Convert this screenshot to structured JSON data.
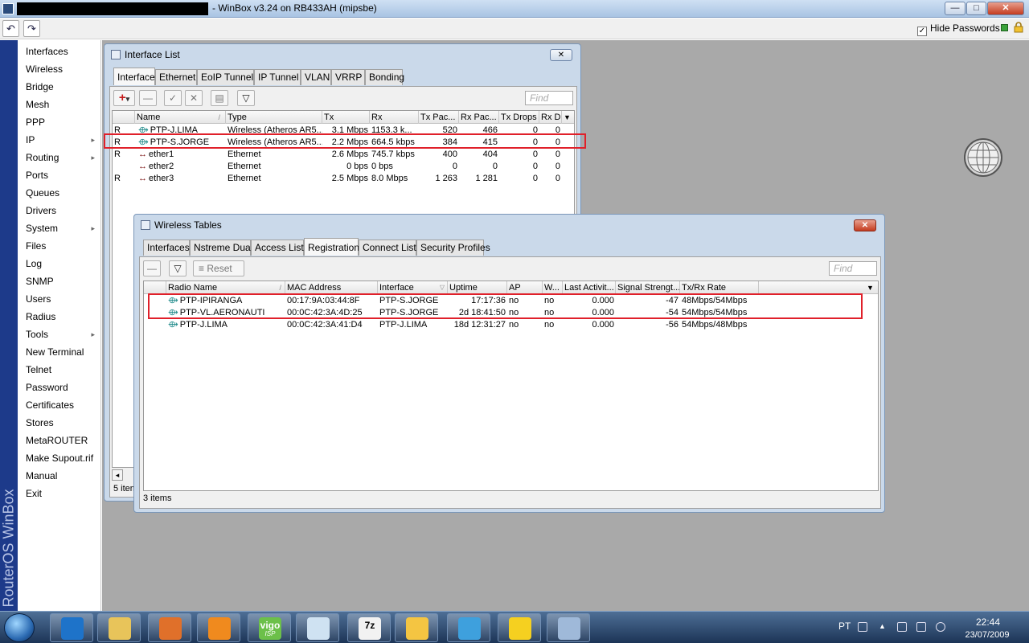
{
  "titlebar": {
    "title": "- WinBox v3.24 on RB433AH (mipsbe)",
    "min": "—",
    "max": "□",
    "close": "✕"
  },
  "toolbar": {
    "undo": "↶",
    "redo": "↷",
    "hide_passwords_label": "Hide Passwords",
    "hide_passwords_checked": "✓"
  },
  "side_label": "RouterOS WinBox",
  "menu": [
    {
      "label": "Interfaces"
    },
    {
      "label": "Wireless"
    },
    {
      "label": "Bridge"
    },
    {
      "label": "Mesh"
    },
    {
      "label": "PPP"
    },
    {
      "label": "IP",
      "arrow": "▸"
    },
    {
      "label": "Routing",
      "arrow": "▸"
    },
    {
      "label": "Ports"
    },
    {
      "label": "Queues"
    },
    {
      "label": "Drivers"
    },
    {
      "label": "System",
      "arrow": "▸"
    },
    {
      "label": "Files"
    },
    {
      "label": "Log"
    },
    {
      "label": "SNMP"
    },
    {
      "label": "Users"
    },
    {
      "label": "Radius"
    },
    {
      "label": "Tools",
      "arrow": "▸"
    },
    {
      "label": "New Terminal"
    },
    {
      "label": "Telnet"
    },
    {
      "label": "Password"
    },
    {
      "label": "Certificates"
    },
    {
      "label": "Stores"
    },
    {
      "label": "MetaROUTER"
    },
    {
      "label": "Make Supout.rif"
    },
    {
      "label": "Manual"
    },
    {
      "label": "Exit"
    }
  ],
  "iface_win": {
    "title": "Interface List",
    "close": "✕",
    "tabs": [
      "Interface",
      "Ethernet",
      "EoIP Tunnel",
      "IP Tunnel",
      "VLAN",
      "VRRP",
      "Bonding"
    ],
    "buttons": {
      "add": "+",
      "add_arrow": "▾",
      "remove": "—",
      "enable": "✓",
      "disable": "✕",
      "comment": "▤",
      "filter": "▽"
    },
    "find_placeholder": "Find",
    "columns": [
      "Name",
      "Type",
      "Tx",
      "Rx",
      "Tx Pac...",
      "Rx Pac...",
      "Tx Drops",
      "Rx D"
    ],
    "sort_arrow": "/",
    "rows": [
      {
        "flag": "R",
        "icon": "⟴",
        "name": "PTP-J.LIMA",
        "type": "Wireless (Atheros AR5...",
        "tx": "3.1 Mbps",
        "rx": "1153.3 k...",
        "txp": "520",
        "rxp": "466",
        "txd": "0",
        "rxd": "0"
      },
      {
        "flag": "R",
        "icon": "⟴",
        "name": "PTP-S.JORGE",
        "type": "Wireless (Atheros AR5...",
        "tx": "2.2 Mbps",
        "rx": "664.5 kbps",
        "txp": "384",
        "rxp": "415",
        "txd": "0",
        "rxd": "0"
      },
      {
        "flag": "R",
        "icon": "↔",
        "name": "ether1",
        "type": "Ethernet",
        "tx": "2.6 Mbps",
        "rx": "745.7 kbps",
        "txp": "400",
        "rxp": "404",
        "txd": "0",
        "rxd": "0"
      },
      {
        "flag": "",
        "icon": "↔",
        "name": "ether2",
        "type": "Ethernet",
        "tx": "0 bps",
        "rx": "0 bps",
        "txp": "0",
        "rxp": "0",
        "txd": "0",
        "rxd": "0"
      },
      {
        "flag": "R",
        "icon": "↔",
        "name": "ether3",
        "type": "Ethernet",
        "tx": "2.5 Mbps",
        "rx": "8.0 Mbps",
        "txp": "1 263",
        "rxp": "1 281",
        "txd": "0",
        "rxd": "0"
      }
    ],
    "status": "5 item",
    "scroll_left": "◂"
  },
  "wireless_win": {
    "title": "Wireless Tables",
    "close": "✕",
    "tabs": [
      "Interfaces",
      "Nstreme Dual",
      "Access List",
      "Registration",
      "Connect List",
      "Security Profiles"
    ],
    "buttons": {
      "remove": "—",
      "filter": "▽",
      "reset": "Reset",
      "reset_icon": "≡"
    },
    "find_placeholder": "Find",
    "columns": [
      "Radio Name",
      "MAC Address",
      "Interface",
      "Uptime",
      "AP",
      "W...",
      "Last Activit...",
      "Signal Strengt...",
      "Tx/Rx Rate"
    ],
    "sort_arrow": "/",
    "filter_arrow": "▽",
    "menu_arrow": "▼",
    "rows": [
      {
        "name": "PTP-IPIRANGA",
        "mac": "00:17:9A:03:44:8F",
        "iface": "PTP-S.JORGE",
        "uptime": "17:17:36",
        "ap": "no",
        "w": "no",
        "last": "0.000",
        "signal": "-47",
        "rate": "48Mbps/54Mbps"
      },
      {
        "name": "PTP-VL.AERONAUTI",
        "mac": "00:0C:42:3A:4D:25",
        "iface": "PTP-S.JORGE",
        "uptime": "2d 18:41:50",
        "ap": "no",
        "w": "no",
        "last": "0.000",
        "signal": "-54",
        "rate": "54Mbps/54Mbps"
      },
      {
        "name": "PTP-J.LIMA",
        "mac": "00:0C:42:3A:41:D4",
        "iface": "PTP-J.LIMA",
        "uptime": "18d 12:31:27",
        "ap": "no",
        "w": "no",
        "last": "0.000",
        "signal": "-56",
        "rate": "54Mbps/48Mbps"
      }
    ],
    "status": "3 items"
  },
  "taskbar": {
    "apps": [
      {
        "name": "internet-explorer",
        "color": "#1e73c9"
      },
      {
        "name": "explorer",
        "color": "#e8c45a"
      },
      {
        "name": "firefox",
        "color": "#e0702a"
      },
      {
        "name": "media-player",
        "color": "#f08a1e"
      },
      {
        "name": "vigo-isp",
        "color": "#6cc04a",
        "label": "vigo",
        "sub": "ISP"
      },
      {
        "name": "winbox",
        "color": "#cfe2f2"
      },
      {
        "name": "7zip",
        "color": "#f2f2f2",
        "label": "7z"
      },
      {
        "name": "outlook",
        "color": "#f4c542"
      },
      {
        "name": "messenger",
        "color": "#3ea0dd"
      },
      {
        "name": "star-app",
        "color": "#f5d020"
      },
      {
        "name": "paint",
        "color": "#9fb9d9"
      }
    ],
    "lang": "PT",
    "time": "22:44",
    "date": "23/07/2009"
  },
  "colors": {
    "highlight": "#e0202a",
    "workspace": "#a9a9a9",
    "side_strip": "#1d3a8a"
  }
}
